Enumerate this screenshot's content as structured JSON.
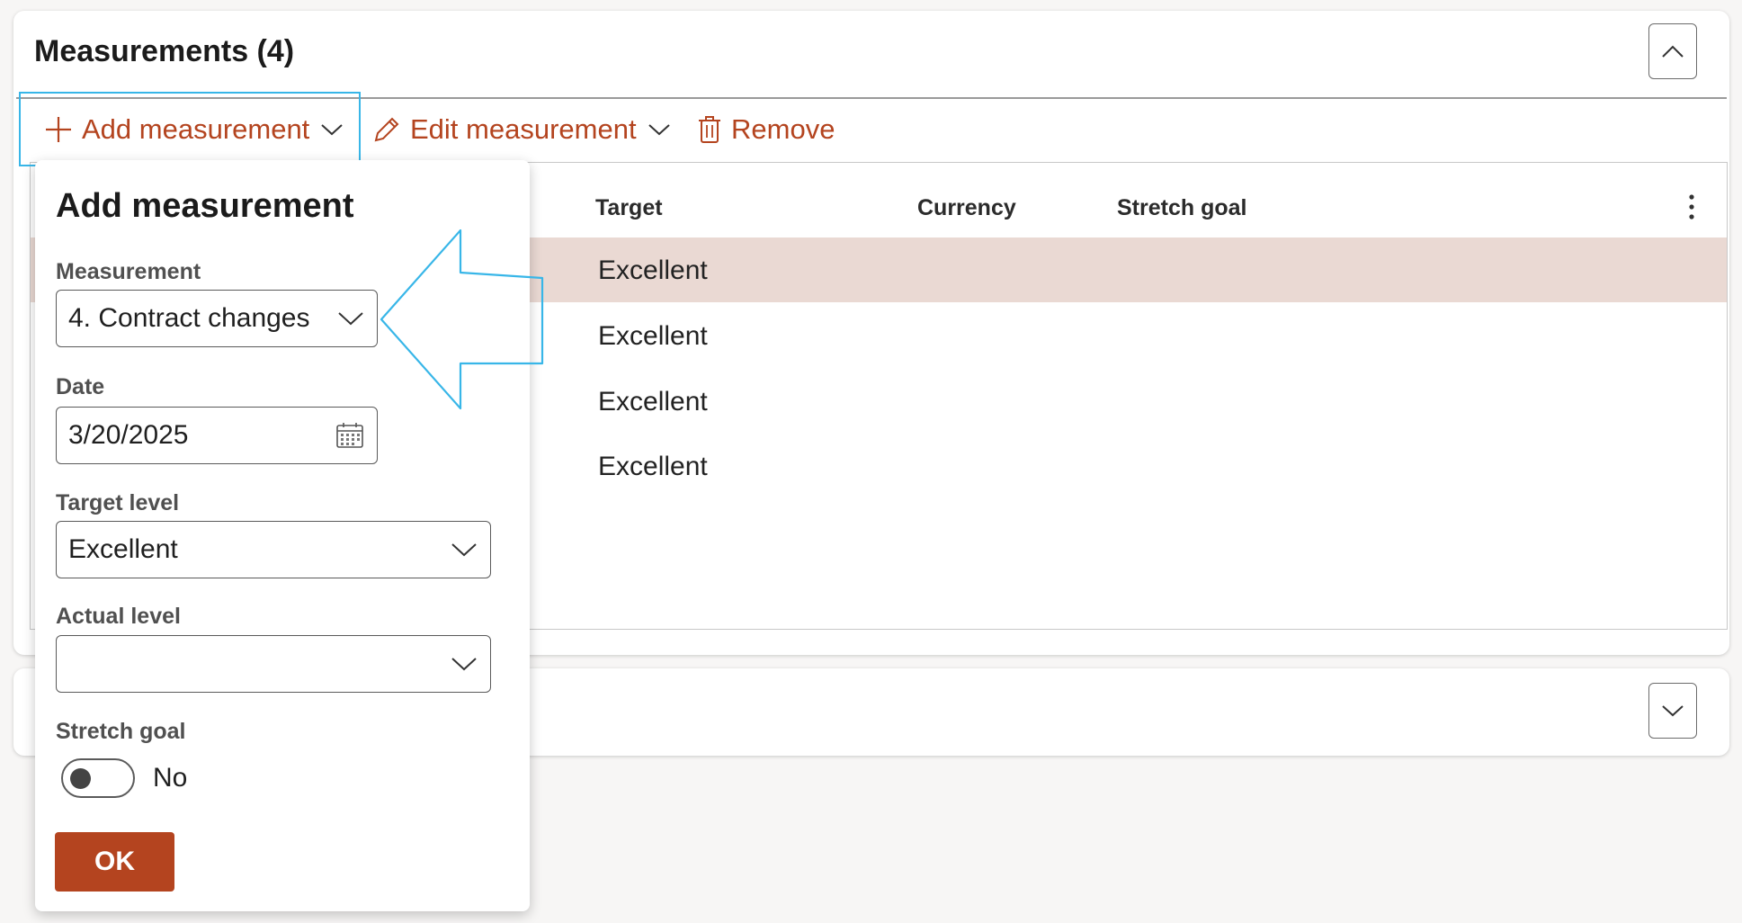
{
  "section": {
    "title": "Measurements (4)"
  },
  "toolbar": {
    "add_label": "Add measurement",
    "edit_label": "Edit measurement",
    "remove_label": "Remove"
  },
  "grid": {
    "columns": [
      "Target",
      "Currency",
      "Stretch goal"
    ],
    "rows": [
      {
        "target": "Excellent",
        "selected": true
      },
      {
        "target": "Excellent",
        "selected": false
      },
      {
        "target": "Excellent",
        "selected": false
      },
      {
        "target": "Excellent",
        "selected": false
      }
    ]
  },
  "flyout": {
    "title": "Add measurement",
    "measurement_label": "Measurement",
    "measurement_value": "4. Contract changes",
    "date_label": "Date",
    "date_value": "3/20/2025",
    "target_level_label": "Target level",
    "target_level_value": "Excellent",
    "actual_level_label": "Actual level",
    "actual_level_value": "",
    "stretch_goal_label": "Stretch goal",
    "stretch_goal_text": "No",
    "stretch_goal_on": false,
    "ok_label": "OK"
  },
  "colors": {
    "accent": "#b4441f",
    "highlight": "#38b6e8",
    "selected_row": "#ead9d3"
  },
  "icons": {
    "add": "plus-icon",
    "edit": "pencil-icon",
    "remove": "trash-icon",
    "dropdown": "chevron-down-icon",
    "collapse": "chevron-up-icon",
    "expand": "chevron-down-icon",
    "calendar": "calendar-icon",
    "more": "more-vertical-icon"
  }
}
